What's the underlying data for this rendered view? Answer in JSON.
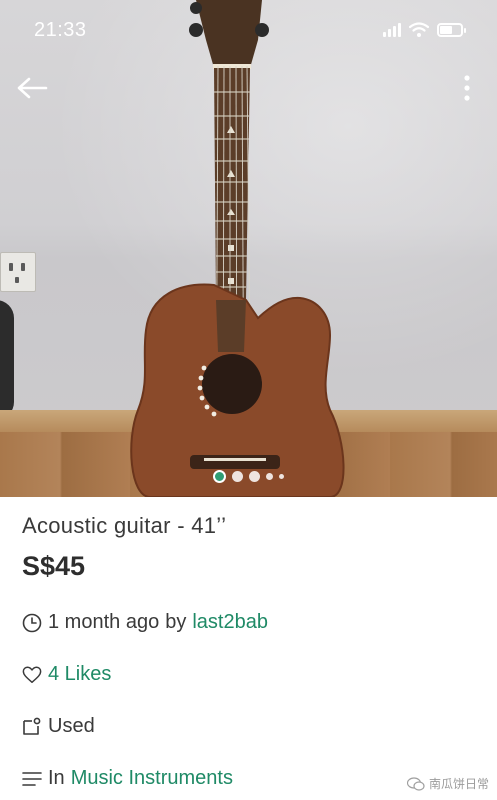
{
  "status_bar": {
    "time": "21:33",
    "battery_level": 0.6
  },
  "nav": {
    "back_icon": "arrow-left-icon",
    "more_icon": "more-vertical-icon"
  },
  "carousel": {
    "total_images": 5,
    "active_index": 0
  },
  "listing": {
    "title": "Acoustic guitar - 41’’",
    "price": "S$45",
    "posted_time": "1 month ago",
    "by_label": "by",
    "seller": "last2bab",
    "likes": "4 Likes",
    "condition": "Used",
    "in_label": "In",
    "category": "Music Instruments"
  },
  "watermark": {
    "text": "南瓜饼日常"
  },
  "colors": {
    "accent": "#1f8a66",
    "text": "#3a3a3a",
    "price": "#2e2e2e"
  }
}
